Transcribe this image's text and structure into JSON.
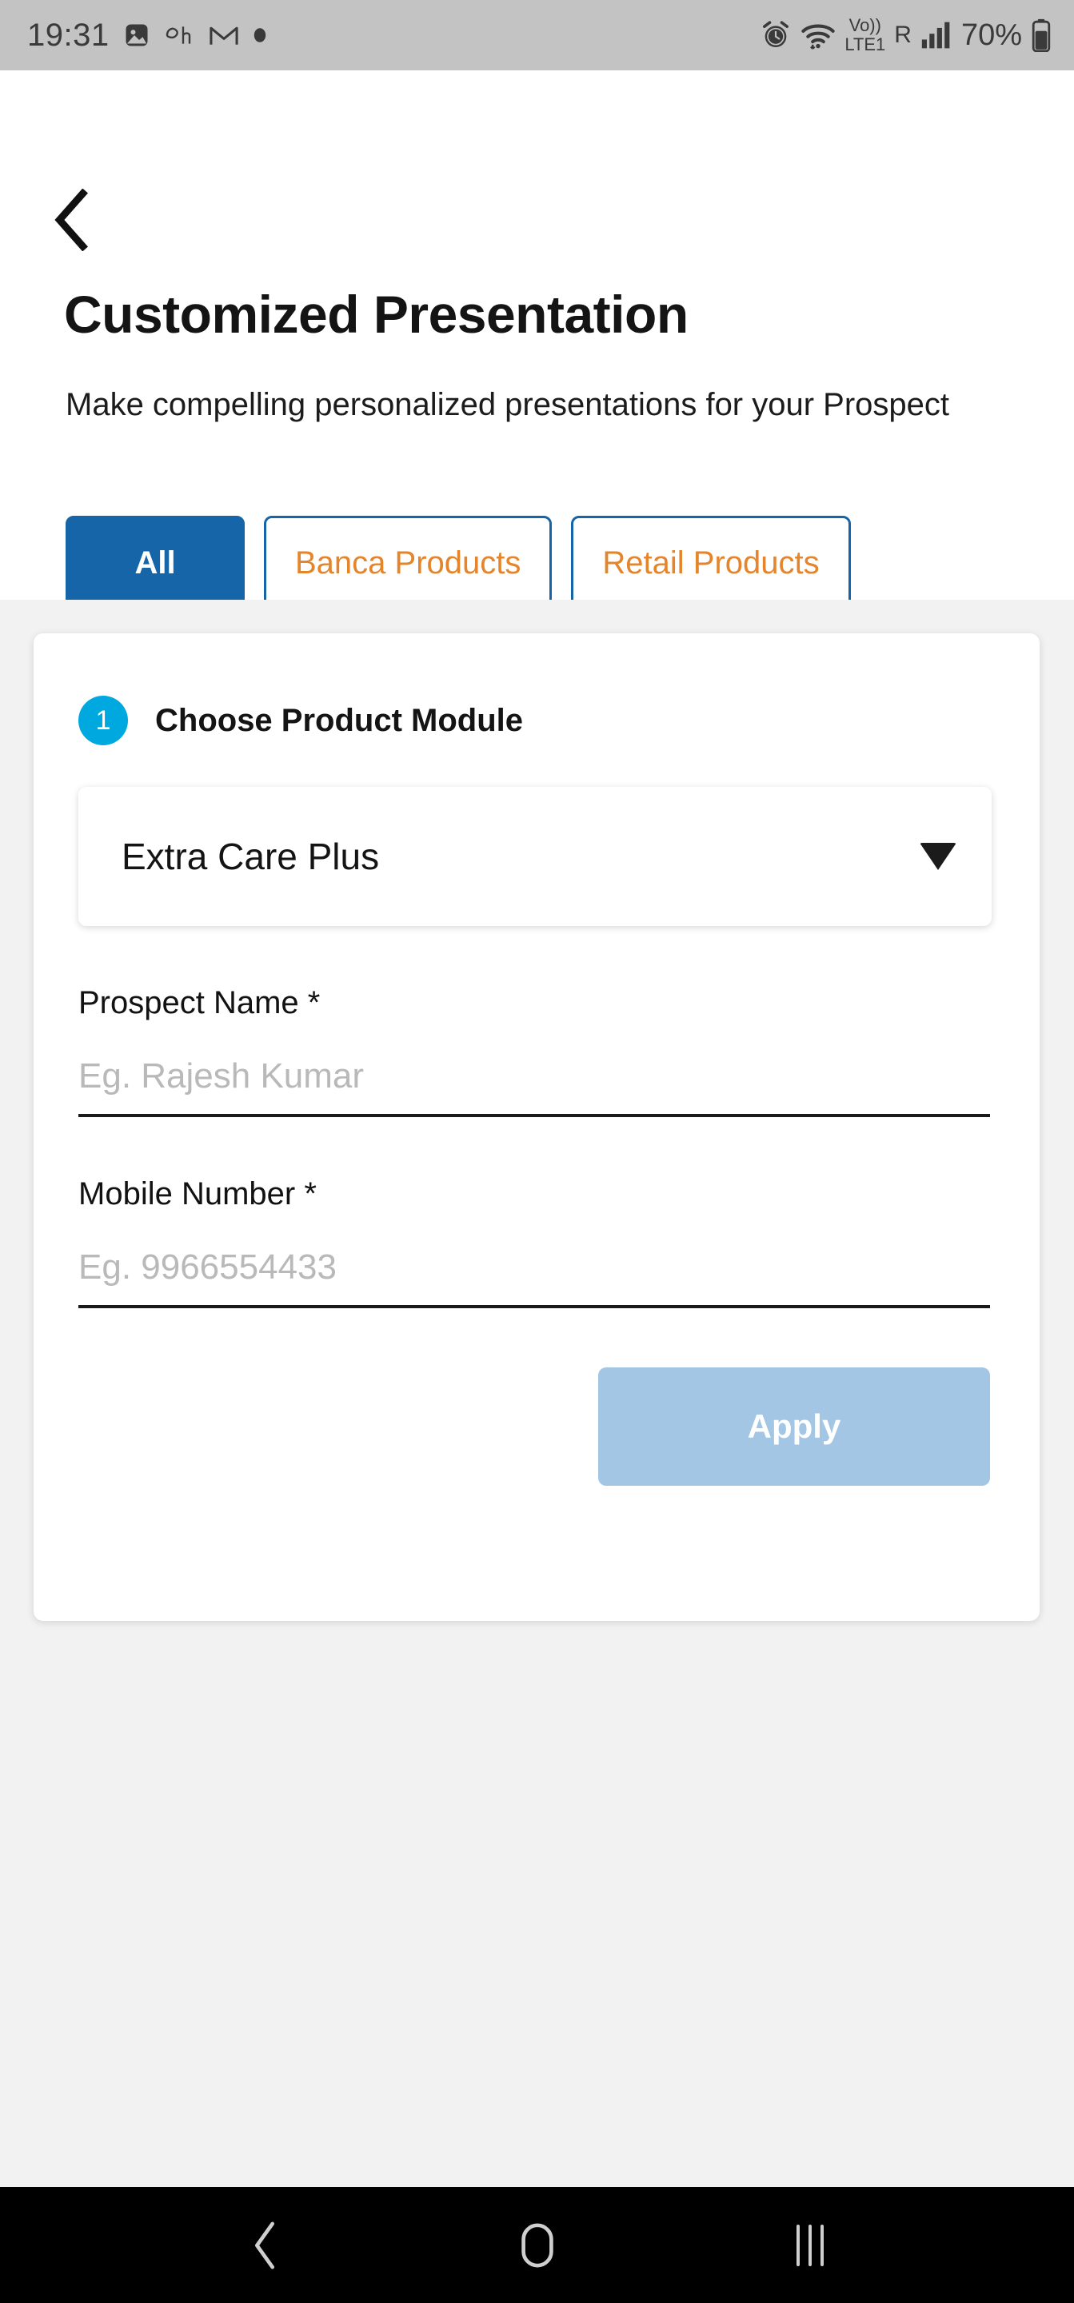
{
  "status_bar": {
    "clock": "19:31",
    "battery_percent": "70%",
    "network_label": "LTE1",
    "volte_label": "Vo))",
    "roaming_label": "R",
    "left_icons": [
      "photos-icon",
      "app-icon",
      "gmail-icon",
      "dot-icon"
    ],
    "right_icons": [
      "alarm-icon",
      "wifi-icon",
      "volte-icon",
      "signal-icon",
      "battery-icon"
    ],
    "bg_color": "#c3c3c3"
  },
  "header": {
    "back_icon": "chevron-left-icon",
    "title": "Customized Presentation",
    "subtitle": "Make compelling personalized presentations for your Prospect",
    "tabs": [
      {
        "label": "All",
        "active": true
      },
      {
        "label": "Banca Products",
        "active": false
      },
      {
        "label": "Retail Products",
        "active": false
      }
    ]
  },
  "card": {
    "step_number": "1",
    "step_label": "Choose Product Module",
    "dropdown": {
      "value": "Extra Care Plus",
      "caret_icon": "chevron-down-icon"
    },
    "fields": [
      {
        "label": "Prospect Name *",
        "value": "",
        "placeholder": "Eg. Rajesh Kumar"
      },
      {
        "label": "Mobile Number *",
        "value": "",
        "placeholder": "Eg. 9966554433"
      }
    ],
    "apply_label": "Apply"
  },
  "nav_bar": {
    "back_icon": "nav-back-icon",
    "home_icon": "nav-home-icon",
    "recents_icon": "nav-recents-icon"
  },
  "colors": {
    "accent_blue": "#1565a8",
    "accent_orange": "#e5852b",
    "step_cyan": "#00a8e0",
    "apply_disabled": "#a3c6e5",
    "page_bg": "#f2f2f2",
    "card_bg": "#ffffff"
  }
}
